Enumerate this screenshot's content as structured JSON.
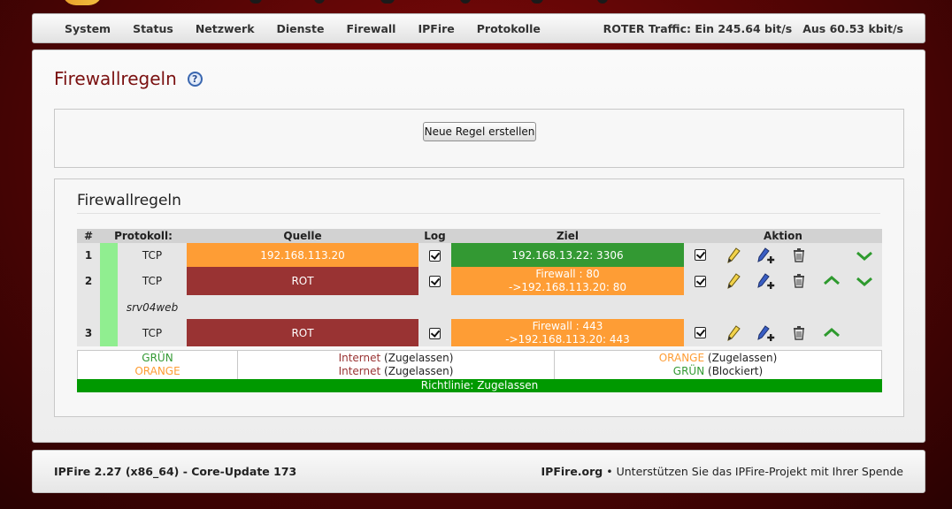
{
  "nav": {
    "items": [
      {
        "label": "System"
      },
      {
        "label": "Status"
      },
      {
        "label": "Netzwerk"
      },
      {
        "label": "Dienste"
      },
      {
        "label": "Firewall"
      },
      {
        "label": "IPFire"
      },
      {
        "label": "Protokolle"
      }
    ],
    "traffic_in": "ROTER Traffic: Ein 245.64 bit/s",
    "traffic_out": "Aus 60.53 kbit/s"
  },
  "page": {
    "title": "Firewallregeln",
    "help_icon": "help-icon"
  },
  "new_rule_button": "Neue Regel erstellen",
  "rules_box": {
    "title": "Firewallregeln",
    "headers": {
      "num": "#",
      "protocol": "Protokoll:",
      "source": "Quelle",
      "log": "Log",
      "target": "Ziel",
      "action": "Aktion"
    },
    "rules": [
      {
        "num": "1",
        "protocol": "TCP",
        "source": "192.168.113.20",
        "source_color": "#fe9d35",
        "target_line1": "192.168.13.22: 3306",
        "target_line2": "",
        "target_color": "#339933",
        "remark": ""
      },
      {
        "num": "2",
        "protocol": "TCP",
        "source": "ROT",
        "source_color": "#993333",
        "target_line1": "Firewall : 80",
        "target_line2": "->192.168.113.20: 80",
        "target_color": "#fe9d35",
        "remark": "srv04web"
      },
      {
        "num": "3",
        "protocol": "TCP",
        "source": "ROT",
        "source_color": "#993333",
        "target_line1": "Firewall : 443",
        "target_line2": "->192.168.113.20: 443",
        "target_color": "#fe9d35",
        "remark": ""
      }
    ]
  },
  "policy": {
    "col1_line1": "GRÜN",
    "col1_line2": "ORANGE",
    "col2_line1_zone": "Internet",
    "col2_line1_state": "(Zugelassen)",
    "col2_line2_zone": "Internet",
    "col2_line2_state": "(Zugelassen)",
    "col3_line1_zone": "ORANGE",
    "col3_line1_state": "(Zugelassen)",
    "col3_line2_zone": "GRÜN",
    "col3_line2_state": "(Blockiert)",
    "bar": "Richtlinie: Zugelassen"
  },
  "footer": {
    "version": "IPFire 2.27 (x86_64) - Core-Update 173",
    "site": "IPFire.org",
    "separator": "•",
    "donate": "Unterstützen Sie das IPFire-Projekt mit Ihrer Spende"
  },
  "colors": {
    "green_zone": "#339933",
    "orange_zone": "#fe9d35",
    "red_zone": "#993333",
    "policy_bar": "#009900"
  }
}
